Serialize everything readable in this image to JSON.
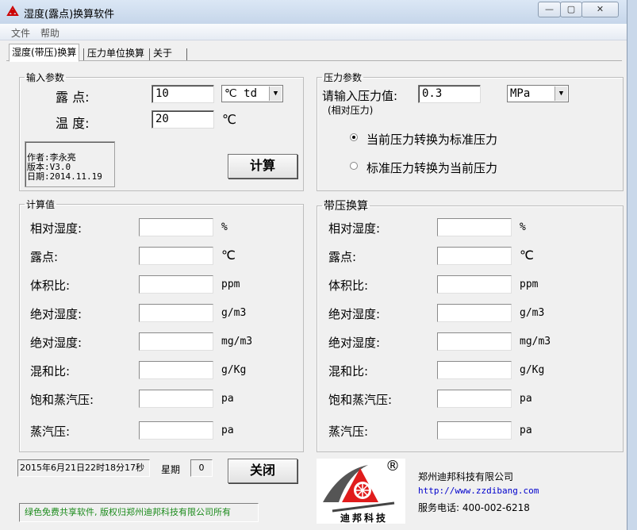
{
  "window": {
    "title": "湿度(露点)换算软件",
    "controls": {
      "minimize": "—",
      "maximize": "▢",
      "close": "✕"
    }
  },
  "menu": {
    "file": "文件",
    "help": "帮助"
  },
  "tabs": [
    {
      "label": "湿度(带压)换算",
      "active": true
    },
    {
      "label": "压力单位换算",
      "active": false
    },
    {
      "label": "关于",
      "active": false
    }
  ],
  "input_params": {
    "legend": "输入参数",
    "dewpoint_label": "露  点:",
    "dewpoint_value": "10",
    "dewpoint_unit": "℃ td",
    "temp_label": "温  度:",
    "temp_value": "20",
    "temp_unit": "℃",
    "info": {
      "author": "作者:李永亮",
      "version": "版本:V3.0",
      "date": "日期:2014.11.19"
    },
    "calc_button": "计算"
  },
  "pressure_params": {
    "legend": "压力参数",
    "label": "请输入压力值:",
    "note": "(相对压力)",
    "value": "0.3",
    "unit": "MPa",
    "option_current_to_std": "当前压力转换为标准压力",
    "option_std_to_current": "标准压力转换为当前压力",
    "selected": "current_to_std"
  },
  "calc_values": {
    "legend": "计算值",
    "rows": [
      {
        "label": "相对湿度:",
        "unit": "%"
      },
      {
        "label": "露点:",
        "unit": "℃"
      },
      {
        "label": "体积比:",
        "unit": "ppm"
      },
      {
        "label": "绝对湿度:",
        "unit": "g/m3"
      },
      {
        "label": "绝对湿度:",
        "unit": "mg/m3"
      },
      {
        "label": "混和比:",
        "unit": "g/Kg"
      },
      {
        "label": "饱和蒸汽压:",
        "unit": "pa"
      },
      {
        "label": "蒸汽压:",
        "unit": "pa"
      }
    ]
  },
  "pressure_conv": {
    "legend": "带压换算",
    "rows": [
      {
        "label": "相对湿度:",
        "unit": "%"
      },
      {
        "label": "露点:",
        "unit": "℃"
      },
      {
        "label": "体积比:",
        "unit": "ppm"
      },
      {
        "label": "绝对湿度:",
        "unit": "g/m3"
      },
      {
        "label": "绝对湿度:",
        "unit": "mg/m3"
      },
      {
        "label": "混和比:",
        "unit": "g/Kg"
      },
      {
        "label": "饱和蒸汽压:",
        "unit": "pa"
      },
      {
        "label": "蒸汽压:",
        "unit": "pa"
      }
    ]
  },
  "footer": {
    "datetime": "2015年6月21日22时18分17秒",
    "weekday_label": "星期",
    "weekday_value": "0",
    "close_button": "关闭",
    "copyright": "绿色免费共享软件, 版权归郑州迪邦科技有限公司所有",
    "company": "郑州迪邦科技有限公司",
    "url": "http://www.zzdibang.com",
    "phone": "服务电话: 400-002-6218",
    "logo_text": "迪邦科技",
    "registered_mark": "®"
  },
  "colors": {
    "logo_red": "#e01c1c",
    "accent_green": "#1a8a1a",
    "link_blue": "#0000cc"
  }
}
